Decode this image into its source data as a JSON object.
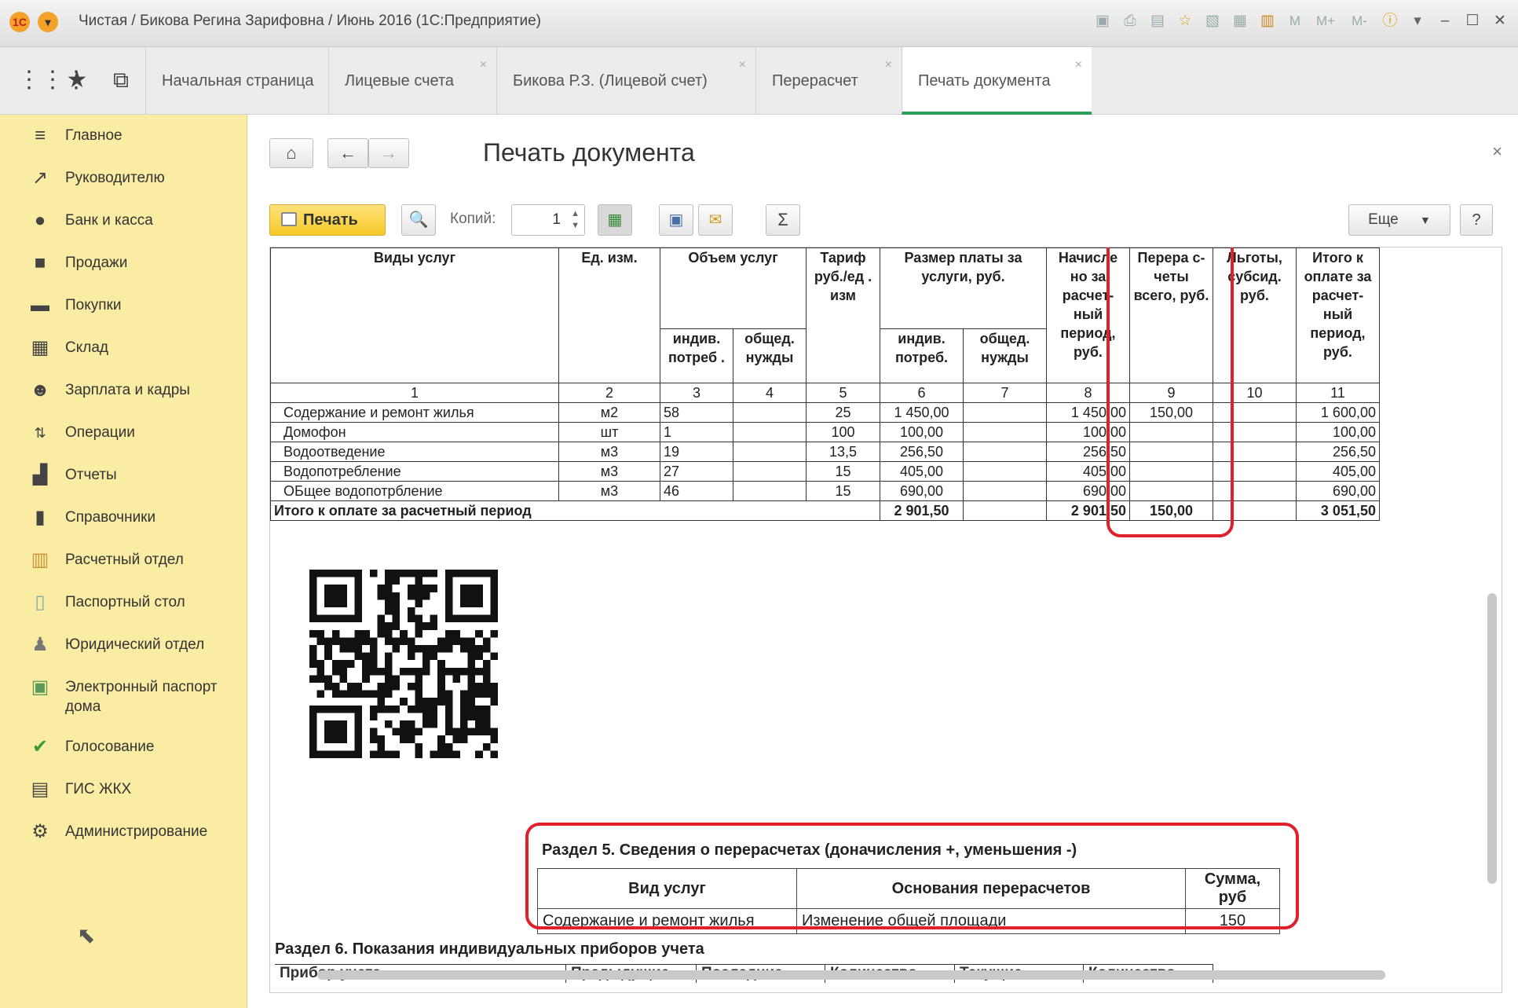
{
  "window": {
    "title": "Чистая / Бикова Регина Зарифовна / Июнь 2016  (1С:Предприятие)",
    "tools": [
      "M",
      "M+",
      "M-"
    ]
  },
  "tabs": [
    {
      "label": "Начальная страница"
    },
    {
      "label": "Лицевые счета",
      "close": "×"
    },
    {
      "label": "Бикова Р.З. (Лицевой счет)",
      "close": "×"
    },
    {
      "label": "Перерасчет",
      "close": "×"
    },
    {
      "label": "Печать документа",
      "close": "×",
      "active": true
    }
  ],
  "sidebar": {
    "items": [
      {
        "label": "Главное",
        "icon": "menu-icon"
      },
      {
        "label": "Руководителю",
        "icon": "trend-icon"
      },
      {
        "label": "Банк и касса",
        "icon": "coin-icon"
      },
      {
        "label": "Продажи",
        "icon": "bag-icon"
      },
      {
        "label": "Покупки",
        "icon": "cart-icon"
      },
      {
        "label": "Склад",
        "icon": "warehouse-icon"
      },
      {
        "label": "Зарплата и кадры",
        "icon": "person-icon"
      },
      {
        "label": "Операции",
        "icon": "operations-icon"
      },
      {
        "label": "Отчеты",
        "icon": "bar-chart-icon"
      },
      {
        "label": "Справочники",
        "icon": "book-icon"
      },
      {
        "label": "Расчетный отдел",
        "icon": "calc-icon"
      },
      {
        "label": "Паспортный стол",
        "icon": "passport-icon"
      },
      {
        "label": "Юридический отдел",
        "icon": "lawyer-icon"
      },
      {
        "label": "Электронный паспорт дома",
        "icon": "epassport-icon"
      },
      {
        "label": "Голосование",
        "icon": "vote-icon"
      },
      {
        "label": "ГИС ЖКХ",
        "icon": "building-icon"
      },
      {
        "label": "Администрирование",
        "icon": "gear-icon"
      }
    ]
  },
  "form": {
    "title": "Печать документа",
    "close": "×",
    "print_label": "Печать",
    "copies_label": "Копий:",
    "copies_value": "1",
    "more_label": "Еще",
    "help_label": "?"
  },
  "report": {
    "head": {
      "services": "Виды услуг",
      "unit": "Ед. изм.",
      "volume": "Объем услуг",
      "tariff": "Тариф руб./ед . изм",
      "payment": "Размер платы за услуги, руб.",
      "accrued": "Начисле но за расчет- ный период, руб.",
      "recalc": "Перера с-четы всего, руб.",
      "benefits": "Льготы, субсид. руб.",
      "total": "Итого к оплате за расчет- ный период, руб.",
      "indiv_cons": "индив. потреб .",
      "common_needs": "общед. нужды",
      "indiv_pay": "индив. потреб.",
      "common_pay": "общед. нужды"
    },
    "col_numbers": [
      "1",
      "2",
      "3",
      "4",
      "5",
      "6",
      "7",
      "8",
      "9",
      "10",
      "11"
    ],
    "rows": [
      {
        "name": "Содержание и ремонт жилья",
        "unit": "м2",
        "indiv": "58",
        "common": "",
        "tariff": "25",
        "pay_indiv": "1 450,00",
        "pay_common": "",
        "accrued": "1 450,00",
        "recalc": "150,00",
        "benefit": "",
        "total": "1 600,00"
      },
      {
        "name": "Домофон",
        "unit": "шт",
        "indiv": "1",
        "common": "",
        "tariff": "100",
        "pay_indiv": "100,00",
        "pay_common": "",
        "accrued": "100,00",
        "recalc": "",
        "benefit": "",
        "total": "100,00"
      },
      {
        "name": "Водоотведение",
        "unit": "м3",
        "indiv": "19",
        "common": "",
        "tariff": "13,5",
        "pay_indiv": "256,50",
        "pay_common": "",
        "accrued": "256,50",
        "recalc": "",
        "benefit": "",
        "total": "256,50"
      },
      {
        "name": "Водопотребление",
        "unit": "м3",
        "indiv": "27",
        "common": "",
        "tariff": "15",
        "pay_indiv": "405,00",
        "pay_common": "",
        "accrued": "405,00",
        "recalc": "",
        "benefit": "",
        "total": "405,00"
      },
      {
        "name": "ОБщее водопотрбление",
        "unit": "м3",
        "indiv": "46",
        "common": "",
        "tariff": "15",
        "pay_indiv": "690,00",
        "pay_common": "",
        "accrued": "690,00",
        "recalc": "",
        "benefit": "",
        "total": "690,00"
      }
    ],
    "totals": {
      "label": "Итого к оплате за расчетный период",
      "pay_indiv": "2 901,50",
      "accrued": "2 901,50",
      "recalc": "150,00",
      "total": "3 051,50"
    }
  },
  "section5": {
    "title": "Раздел 5. Сведения о перерасчетах (доначисления +, уменьшения -)",
    "headers": [
      "Вид услуг",
      "Основания перерасчетов",
      "Сумма, руб"
    ],
    "row": [
      "Содержание и ремонт жилья",
      "Изменение общей площади",
      "150"
    ]
  },
  "section6": {
    "title": "Раздел 6. Показания индивидуальных приборов учета",
    "headers": [
      "Прибор учета",
      "Предыдущие",
      "Последние",
      "Количество",
      "Текущие",
      "Количество"
    ]
  }
}
